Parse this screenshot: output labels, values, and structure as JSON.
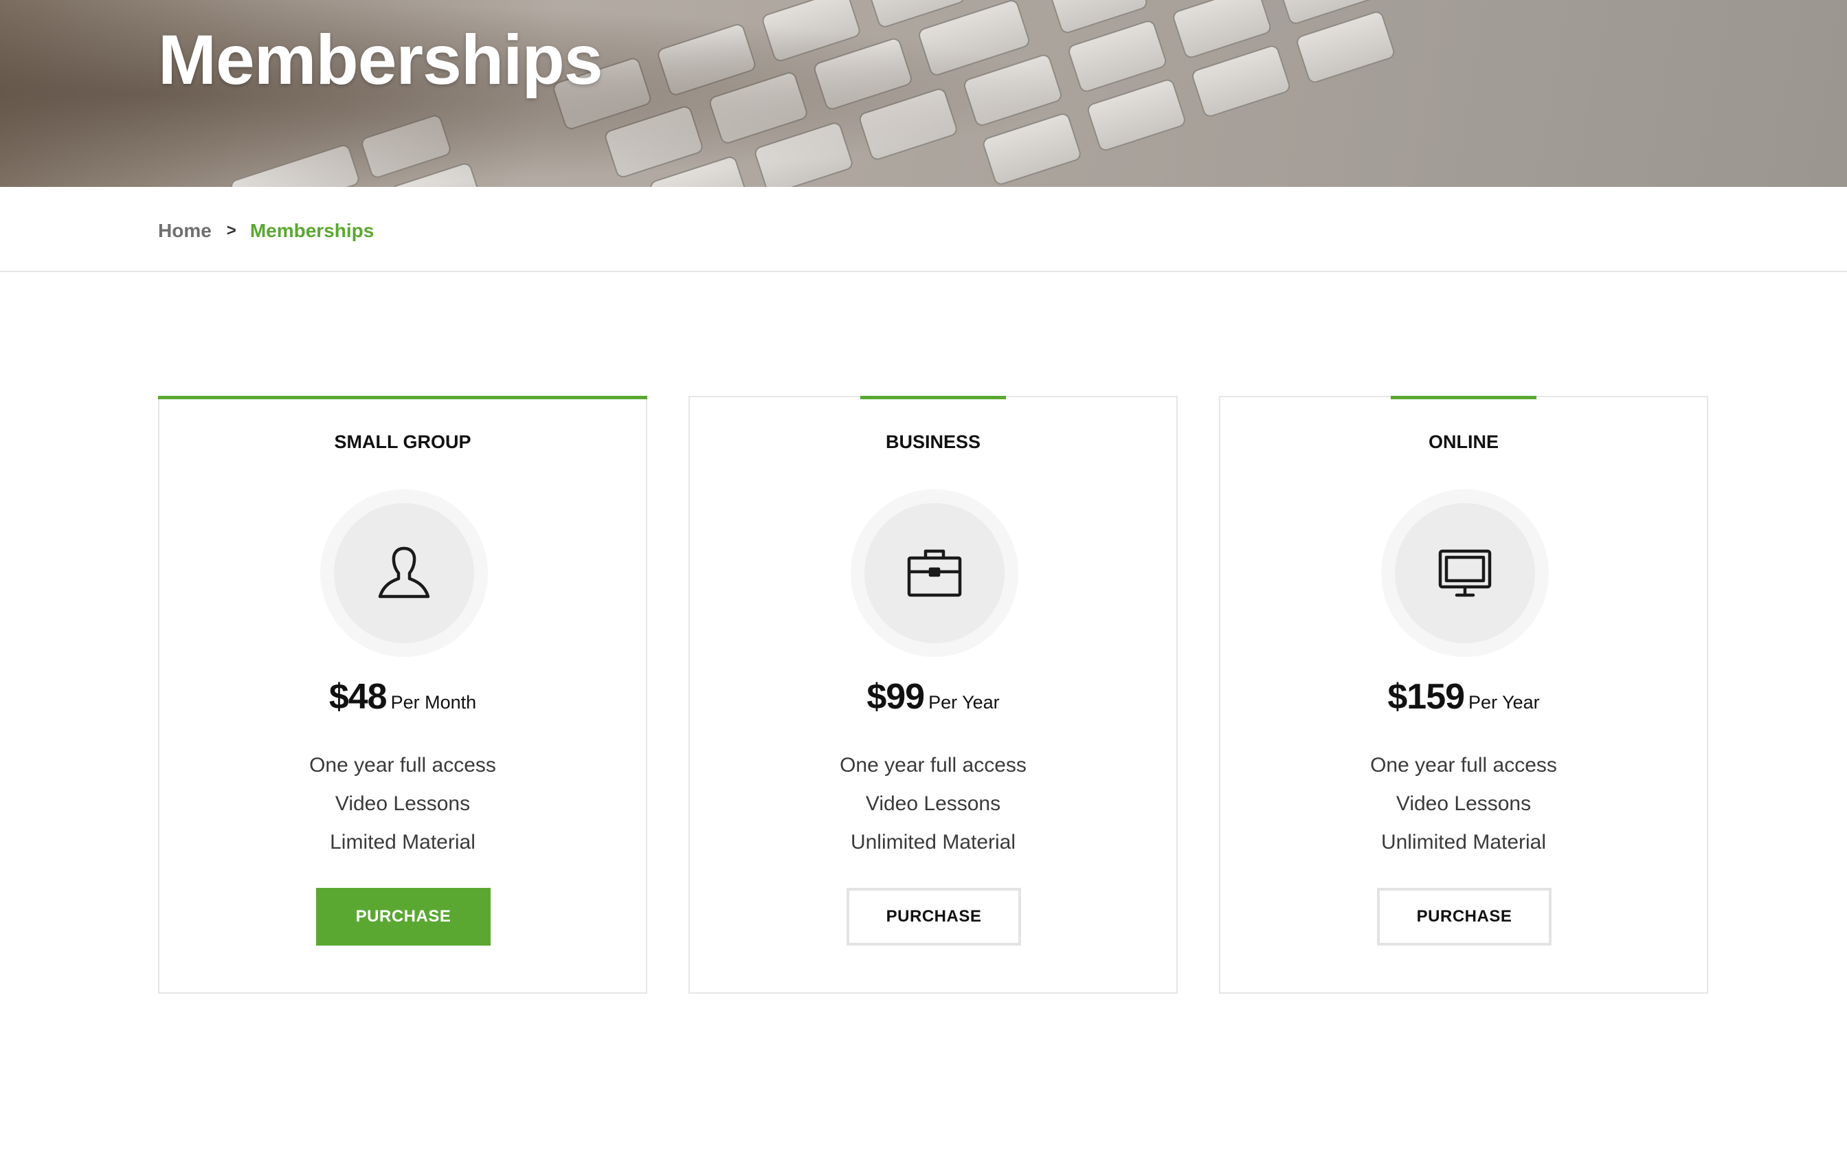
{
  "hero": {
    "title": "Memberships"
  },
  "breadcrumb": {
    "home": "Home",
    "separator": ">",
    "current": "Memberships"
  },
  "colors": {
    "accent": "#5aa832",
    "card_border": "#e6e6e6",
    "icon_bg": "#ececec"
  },
  "plans": [
    {
      "name": "SMALL GROUP",
      "icon": "user-icon",
      "price": "$48",
      "period": "Per Month",
      "features": [
        "One year full access",
        "Video Lessons",
        "Limited Material"
      ],
      "button": "PURCHASE",
      "featured": true
    },
    {
      "name": "BUSINESS",
      "icon": "briefcase-icon",
      "price": "$99",
      "period": "Per Year",
      "features": [
        "One year full access",
        "Video Lessons",
        "Unlimited Material"
      ],
      "button": "PURCHASE",
      "featured": false
    },
    {
      "name": "ONLINE",
      "icon": "monitor-icon",
      "price": "$159",
      "period": "Per Year",
      "features": [
        "One year full access",
        "Video Lessons",
        "Unlimited Material"
      ],
      "button": "PURCHASE",
      "featured": false
    }
  ]
}
